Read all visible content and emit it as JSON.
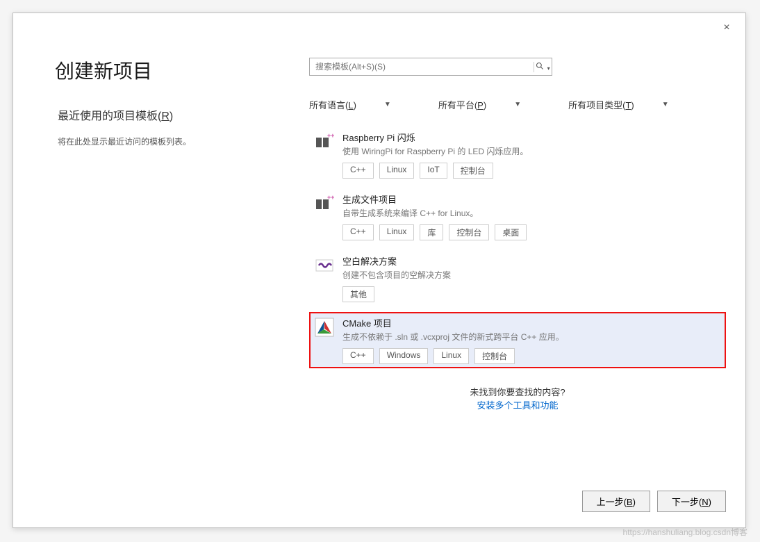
{
  "dialog": {
    "title": "创建新项目",
    "close_label": "×"
  },
  "recent": {
    "title_prefix": "最近使用的项目模板(",
    "title_key": "R",
    "title_suffix": ")",
    "description": "将在此处显示最近访问的模板列表。"
  },
  "search": {
    "placeholder": "搜索模板(Alt+S)(S)",
    "icon": "🔍"
  },
  "filters": {
    "language": {
      "label": "所有语言(",
      "key": "L",
      "suffix": ")"
    },
    "platform": {
      "label": "所有平台(",
      "key": "P",
      "suffix": ")"
    },
    "type": {
      "label": "所有项目类型(",
      "key": "T",
      "suffix": ")"
    }
  },
  "templates": [
    {
      "title": "Raspberry Pi 闪烁",
      "desc": "使用 WiringPi for Raspberry Pi 的 LED 闪烁应用。",
      "tags": [
        "C++",
        "Linux",
        "IoT",
        "控制台"
      ]
    },
    {
      "title": "生成文件项目",
      "desc": "自带生成系统来编译 C++ for Linux。",
      "tags": [
        "C++",
        "Linux",
        "库",
        "控制台",
        "桌面"
      ]
    },
    {
      "title": "空白解决方案",
      "desc": "创建不包含项目的空解决方案",
      "tags": [
        "其他"
      ]
    },
    {
      "title": "CMake 项目",
      "desc": "生成不依赖于 .sln 或 .vcxproj 文件的新式跨平台 C++ 应用。",
      "tags": [
        "C++",
        "Windows",
        "Linux",
        "控制台"
      ],
      "selected": true
    }
  ],
  "notfound": {
    "question": "未找到你要查找的内容?",
    "link": "安装多个工具和功能"
  },
  "buttons": {
    "back": {
      "label": "上一步(",
      "key": "B",
      "suffix": ")"
    },
    "next": {
      "label": "下一步(",
      "key": "N",
      "suffix": ")"
    }
  },
  "watermark": "https://hanshuliang.blog.csdn博客"
}
